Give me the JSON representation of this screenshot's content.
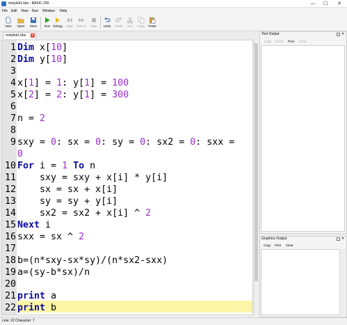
{
  "window": {
    "title": "motylek1.kbs - BASIC-256",
    "minimize": "—",
    "maximize": "☐",
    "close": "✕"
  },
  "menu": [
    "File",
    "Edit",
    "View",
    "Run",
    "Window",
    "Help"
  ],
  "toolbar": {
    "new": "New",
    "open": "Open",
    "save": "Save",
    "run": "Run",
    "debug": "Debug",
    "step": "Step",
    "run_to": "Run to",
    "stop": "Stop",
    "undo": "Undo",
    "redo": "Redo",
    "cut": "Cut",
    "copy": "Copy",
    "paste": "Paste"
  },
  "tab": {
    "label": "motylek1.kbs",
    "close": "x"
  },
  "editor": {
    "line_numbers": [
      "1",
      "2",
      "3",
      "4",
      "5",
      "6",
      "7",
      "8",
      "9",
      "",
      "10",
      "11",
      "12",
      "13",
      "14",
      "15",
      "16",
      "17",
      "18",
      "19",
      "20",
      "21",
      "22"
    ],
    "lines": [
      [
        {
          "t": "Dim",
          "c": "kw"
        },
        {
          "t": " x[",
          "c": ""
        },
        {
          "t": "10",
          "c": "num"
        },
        {
          "t": "]",
          "c": ""
        }
      ],
      [
        {
          "t": "Dim",
          "c": "kw"
        },
        {
          "t": " y[",
          "c": ""
        },
        {
          "t": "10",
          "c": "num"
        },
        {
          "t": "]",
          "c": ""
        }
      ],
      [],
      [
        {
          "t": "x[",
          "c": ""
        },
        {
          "t": "1",
          "c": "num"
        },
        {
          "t": "] = ",
          "c": ""
        },
        {
          "t": "1",
          "c": "num"
        },
        {
          "t": ": y[",
          "c": ""
        },
        {
          "t": "1",
          "c": "num"
        },
        {
          "t": "] = ",
          "c": ""
        },
        {
          "t": "100",
          "c": "num"
        }
      ],
      [
        {
          "t": "x[",
          "c": ""
        },
        {
          "t": "2",
          "c": "num"
        },
        {
          "t": "] = ",
          "c": ""
        },
        {
          "t": "2",
          "c": "num"
        },
        {
          "t": ": y[",
          "c": ""
        },
        {
          "t": "1",
          "c": "num"
        },
        {
          "t": "] = ",
          "c": ""
        },
        {
          "t": "300",
          "c": "num"
        }
      ],
      [],
      [
        {
          "t": "n = ",
          "c": ""
        },
        {
          "t": "2",
          "c": "num"
        }
      ],
      [],
      [
        {
          "t": "sxy = ",
          "c": ""
        },
        {
          "t": "0",
          "c": "num"
        },
        {
          "t": ": sx = ",
          "c": ""
        },
        {
          "t": "0",
          "c": "num"
        },
        {
          "t": ": sy = ",
          "c": ""
        },
        {
          "t": "0",
          "c": "num"
        },
        {
          "t": ": sx2 = ",
          "c": ""
        },
        {
          "t": "0",
          "c": "num"
        },
        {
          "t": ": sxx =",
          "c": ""
        }
      ],
      [
        {
          "t": "0",
          "c": "num"
        }
      ],
      [
        {
          "t": "For",
          "c": "kw"
        },
        {
          "t": " i = ",
          "c": ""
        },
        {
          "t": "1",
          "c": "num"
        },
        {
          "t": " ",
          "c": ""
        },
        {
          "t": "To",
          "c": "kw"
        },
        {
          "t": " n",
          "c": ""
        }
      ],
      [
        {
          "t": "    sxy = sxy + x[i] * y[i]",
          "c": ""
        }
      ],
      [
        {
          "t": "    sx = sx + x[i]",
          "c": ""
        }
      ],
      [
        {
          "t": "    sy = sy + y[i]",
          "c": ""
        }
      ],
      [
        {
          "t": "    sx2 = sx2 + x[i] ^ ",
          "c": ""
        },
        {
          "t": "2",
          "c": "num"
        }
      ],
      [
        {
          "t": "Next",
          "c": "kw"
        },
        {
          "t": " i",
          "c": ""
        }
      ],
      [
        {
          "t": "sxx = sx ^ ",
          "c": ""
        },
        {
          "t": "2",
          "c": "num"
        }
      ],
      [],
      [
        {
          "t": "b=(n*sxy-sx*sy)/(n*sx2-sxx)",
          "c": ""
        }
      ],
      [
        {
          "t": "a=(sy-b*sx)/n",
          "c": ""
        }
      ],
      [],
      [
        {
          "t": "print",
          "c": "kw"
        },
        {
          "t": " a",
          "c": ""
        }
      ],
      [
        {
          "t": "print",
          "c": "kw"
        },
        {
          "t": " b",
          "c": ""
        }
      ]
    ]
  },
  "text_output": {
    "title": "Text Output",
    "buttons": [
      "Copy",
      "Paste",
      "Print",
      "Clear"
    ],
    "enabled": [
      false,
      false,
      true,
      false
    ]
  },
  "graphics_output": {
    "title": "Graphics Output",
    "buttons": [
      "Copy",
      "Print",
      "Clear"
    ]
  },
  "status": {
    "text": "Line: 22 Character: 7"
  },
  "colors": {
    "keyword": "#0a0a9a",
    "number": "#9b2ad1",
    "current_line": "#fbf5a5",
    "gutter": "#e4e4e4"
  }
}
